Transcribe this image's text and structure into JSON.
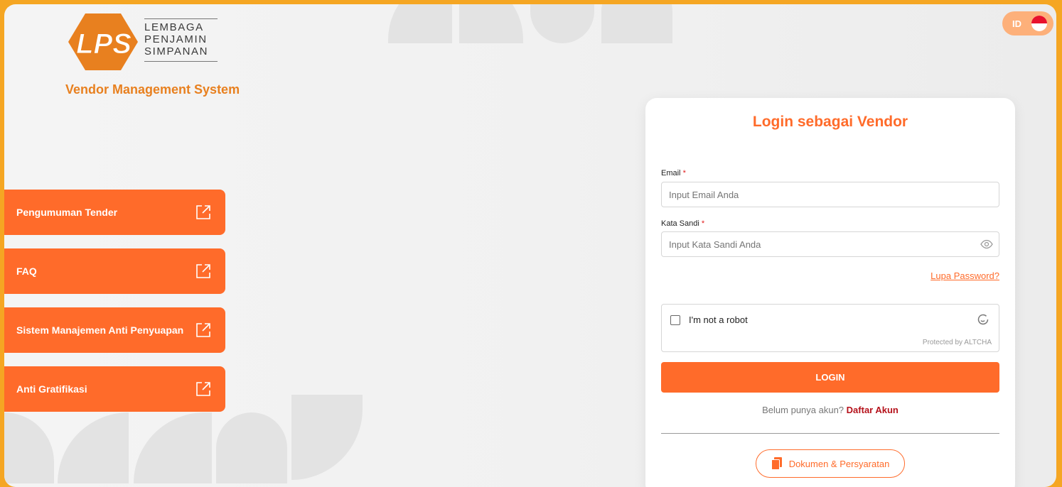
{
  "brand": {
    "name_lines": [
      "LEMBAGA",
      "PENJAMIN",
      "SIMPANAN"
    ],
    "logo_letters": "LPS",
    "subtitle": "Vendor Management System"
  },
  "nav": [
    {
      "label": "Pengumuman Tender"
    },
    {
      "label": "FAQ"
    },
    {
      "label": "Sistem Manajemen Anti Penyuapan"
    },
    {
      "label": "Anti Gratifikasi"
    }
  ],
  "lang": {
    "code": "ID"
  },
  "login": {
    "title": "Login sebagai Vendor",
    "email_label": "Email",
    "email_placeholder": "Input Email Anda",
    "password_label": "Kata Sandi",
    "password_placeholder": "Input Kata Sandi Anda",
    "required_mark": "*",
    "forgot": "Lupa Password?",
    "captcha_label": "I'm not a robot",
    "captcha_footer": "Protected by ALTCHA",
    "submit": "LOGIN",
    "signup_prompt": "Belum punya akun?",
    "signup_link": "Daftar Akun",
    "docs_button": "Dokumen & Persyaratan"
  },
  "colors": {
    "accent": "#ff6b2a",
    "border": "#f5a623",
    "brand_orange": "#e8801f",
    "link_red": "#b5121b"
  }
}
